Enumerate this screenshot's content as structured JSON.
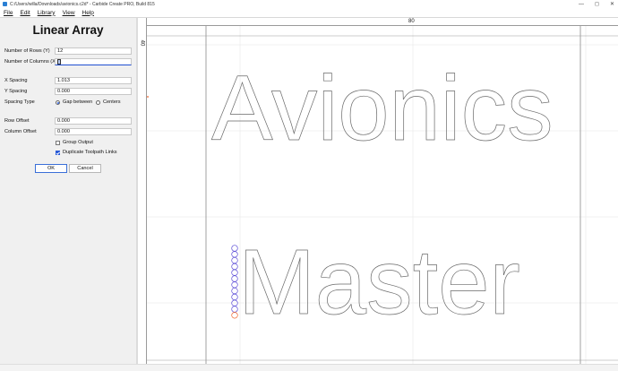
{
  "window": {
    "title": "C:/Users/willa/Downloads/avionics.c2d* - Carbide Create PRO, Build 815"
  },
  "menu": [
    "File",
    "Edit",
    "Library",
    "View",
    "Help"
  ],
  "dialog": {
    "title": "Linear Array",
    "rows_label": "Number of Rows (Y)",
    "rows_value": "12",
    "cols_label": "Number of Columns (X)",
    "cols_value": "1",
    "x_spacing_label": "X Spacing",
    "x_spacing_value": "1.013",
    "y_spacing_label": "Y Spacing",
    "y_spacing_value": "0.000",
    "spacing_type_label": "Spacing Type",
    "spacing_gap_label": "Gap between",
    "spacing_centers_label": "Centers",
    "spacing_type_selected": "Gap between",
    "row_offset_label": "Row Offset",
    "row_offset_value": "0.000",
    "col_offset_label": "Column Offset",
    "col_offset_value": "0.000",
    "group_output_label": "Group Output",
    "group_output_checked": false,
    "dup_links_label": "Duplicate Toolpath Links",
    "dup_links_checked": true,
    "ok_label": "OK",
    "cancel_label": "Cancel"
  },
  "canvas": {
    "ruler_top_label": "80",
    "ruler_left_label": "40",
    "text_line1": "Avionics",
    "text_line2": "Master",
    "array_circle_count": 12,
    "colors": {
      "outline": "#6b6b6b",
      "array": "#5a4bd6",
      "accent": "#f0642a"
    }
  }
}
